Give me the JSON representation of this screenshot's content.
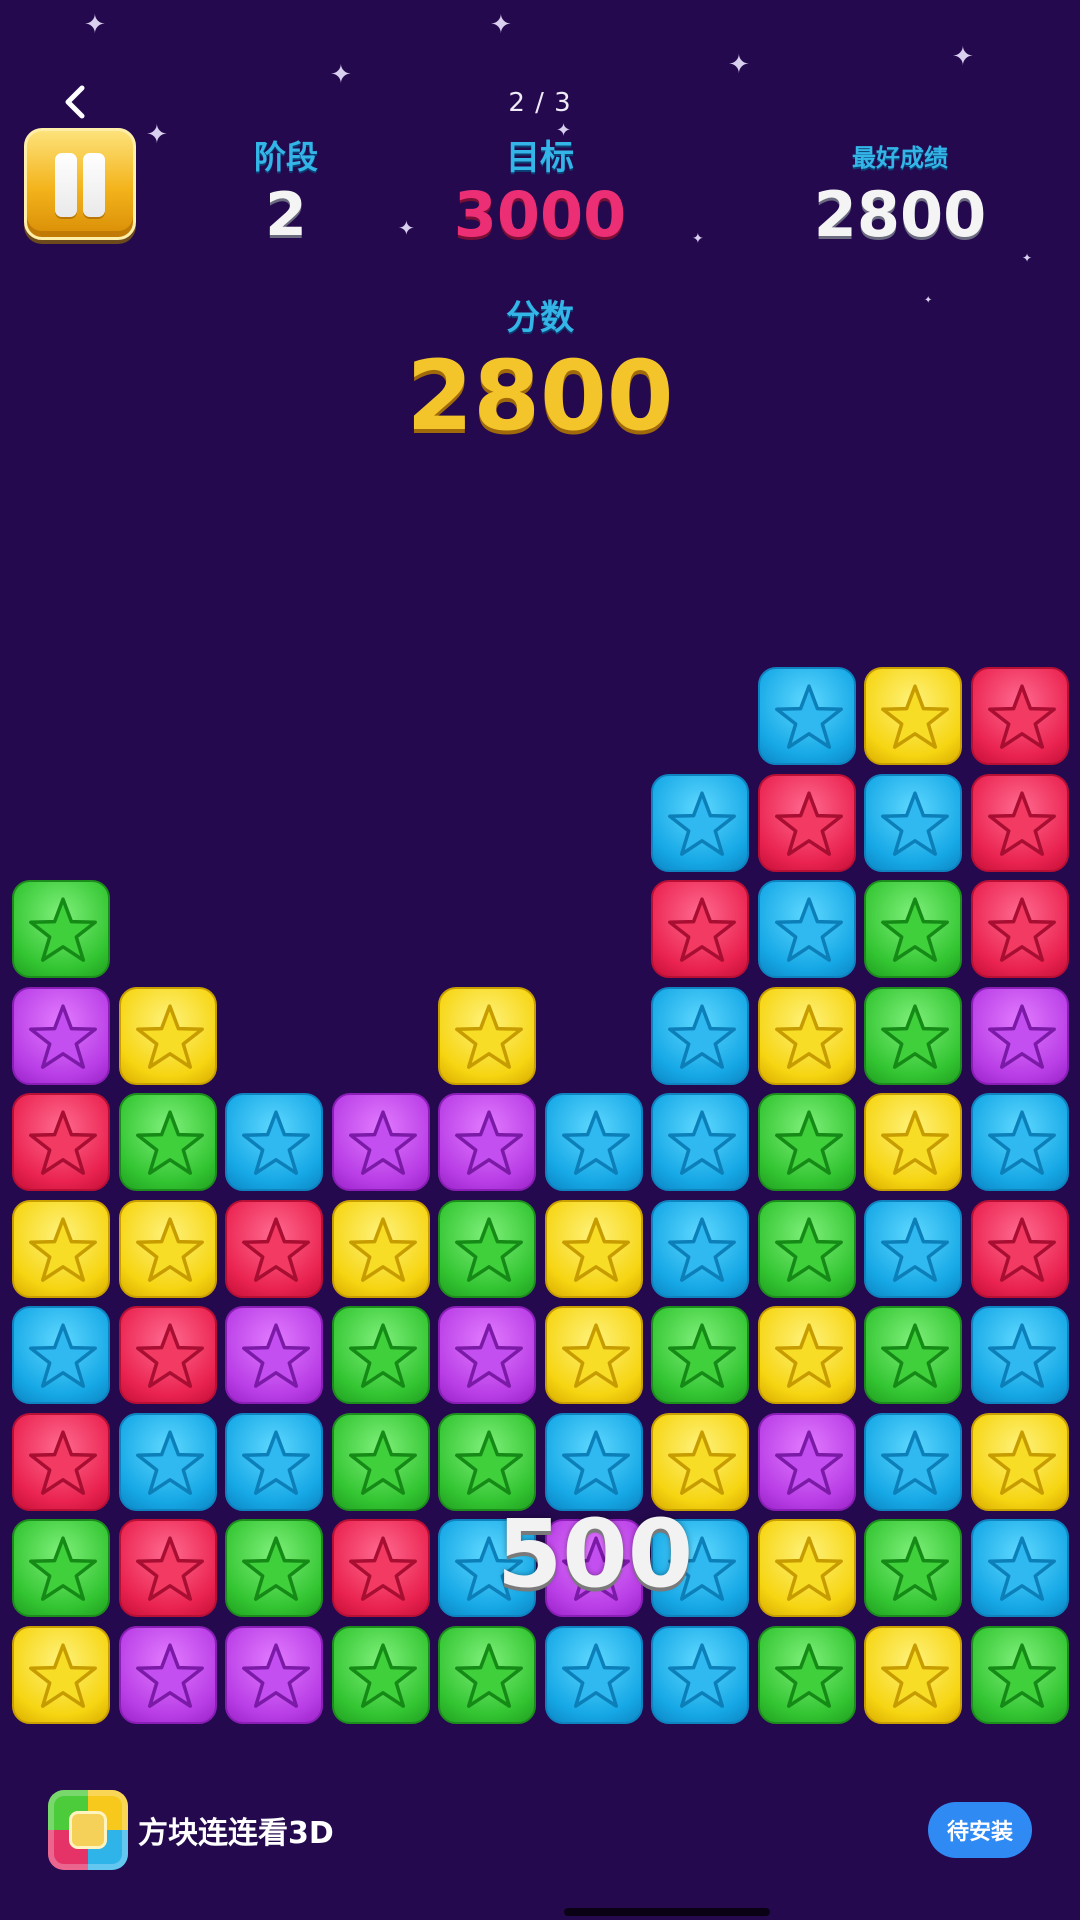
{
  "header": {
    "page_indicator": "2 / 3"
  },
  "stats": {
    "stage_label": "阶段",
    "stage_value": "2",
    "target_label": "目标",
    "target_value": "3000",
    "best_label": "最好成绩",
    "best_value": "2800",
    "score_label": "分数",
    "score_value": "2800"
  },
  "popup": {
    "points": "500"
  },
  "board": {
    "columns": 10,
    "rows": 10,
    "cells": [
      [
        null,
        null,
        null,
        null,
        null,
        null,
        null,
        "blue",
        "yellow",
        "red"
      ],
      [
        null,
        null,
        null,
        null,
        null,
        null,
        "blue",
        "red",
        "blue",
        "red"
      ],
      [
        "green",
        null,
        null,
        null,
        null,
        null,
        "red",
        "blue",
        "green",
        "red"
      ],
      [
        "purple",
        "yellow",
        null,
        null,
        "yellow",
        null,
        "blue",
        "yellow",
        "green",
        "purple"
      ],
      [
        "red",
        "green",
        "blue",
        "purple",
        "purple",
        "blue",
        "blue",
        "green",
        "yellow",
        "blue"
      ],
      [
        "yellow",
        "yellow",
        "red",
        "yellow",
        "green",
        "yellow",
        "blue",
        "green",
        "blue",
        "red"
      ],
      [
        "blue",
        "red",
        "purple",
        "green",
        "purple",
        "yellow",
        "green",
        "yellow",
        "green",
        "blue"
      ],
      [
        "red",
        "blue",
        "blue",
        "green",
        "green",
        "blue",
        "yellow",
        "purple",
        "blue",
        "yellow"
      ],
      [
        "green",
        "red",
        "green",
        "red",
        "blue",
        "purple",
        "blue",
        "yellow",
        "green",
        "blue"
      ],
      [
        "yellow",
        "purple",
        "purple",
        "green",
        "green",
        "blue",
        "blue",
        "green",
        "yellow",
        "green"
      ]
    ]
  },
  "ad": {
    "title": "方块连连看3D",
    "button_label": "待安装"
  },
  "colors": {
    "background": "#24094f",
    "label_blue": "#34b5e8",
    "target_pink": "#ec2f74",
    "score_gold": "#f4c52b"
  }
}
